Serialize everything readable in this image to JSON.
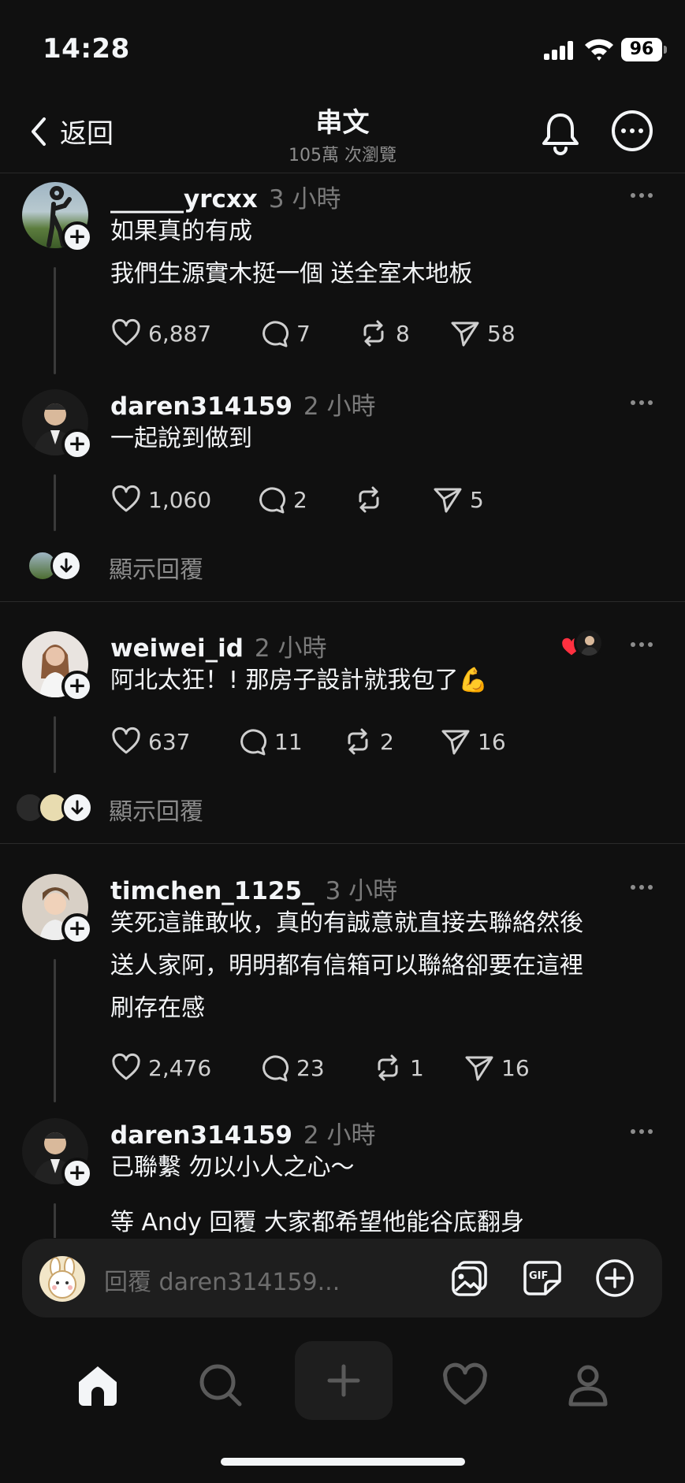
{
  "status": {
    "time": "14:28",
    "battery": "96"
  },
  "header": {
    "back_label": "返回",
    "title": "串文",
    "subtitle": "105萬 次瀏覽"
  },
  "posts": [
    {
      "username": "______yrcxx",
      "time": "3 小時",
      "lines": [
        "如果真的有成",
        "我們生源實木挺一個 送全室木地板"
      ],
      "likes": "6,887",
      "comments": "7",
      "reposts": "8",
      "shares": "58"
    },
    {
      "username": "daren314159",
      "time": "2 小時",
      "lines": [
        "一起說到做到"
      ],
      "likes": "1,060",
      "comments": "2",
      "reposts": "",
      "shares": "5",
      "show_replies": "顯示回覆"
    },
    {
      "username": "weiwei_id",
      "time": "2 小時",
      "lines": [
        "阿北太狂！! 那房子設計就我包了💪"
      ],
      "likes": "637",
      "comments": "11",
      "reposts": "2",
      "shares": "16",
      "show_replies": "顯示回覆"
    },
    {
      "username": "timchen_1125_",
      "time": "3 小時",
      "lines": [
        "笑死這誰敢收，真的有誠意就直接去聯絡然後",
        "送人家阿，明明都有信箱可以聯絡卻要在這裡",
        "刷存在感"
      ],
      "likes": "2,476",
      "comments": "23",
      "reposts": "1",
      "shares": "16"
    },
    {
      "username": "daren314159",
      "time": "2 小時",
      "lines": [
        "已聯繫 勿以小人之心～",
        "等 Andy 回覆 大家都希望他能谷底翻身"
      ]
    }
  ],
  "reply_bar": {
    "placeholder": "回覆 daren314159..."
  },
  "nav": [
    "home-icon",
    "search-icon",
    "create-icon",
    "activity-heart-icon",
    "profile-icon"
  ],
  "colors": {
    "background": "#101010",
    "text": "#f3f5f7",
    "muted": "#8d8d8d",
    "like_red": "#ff3040"
  }
}
